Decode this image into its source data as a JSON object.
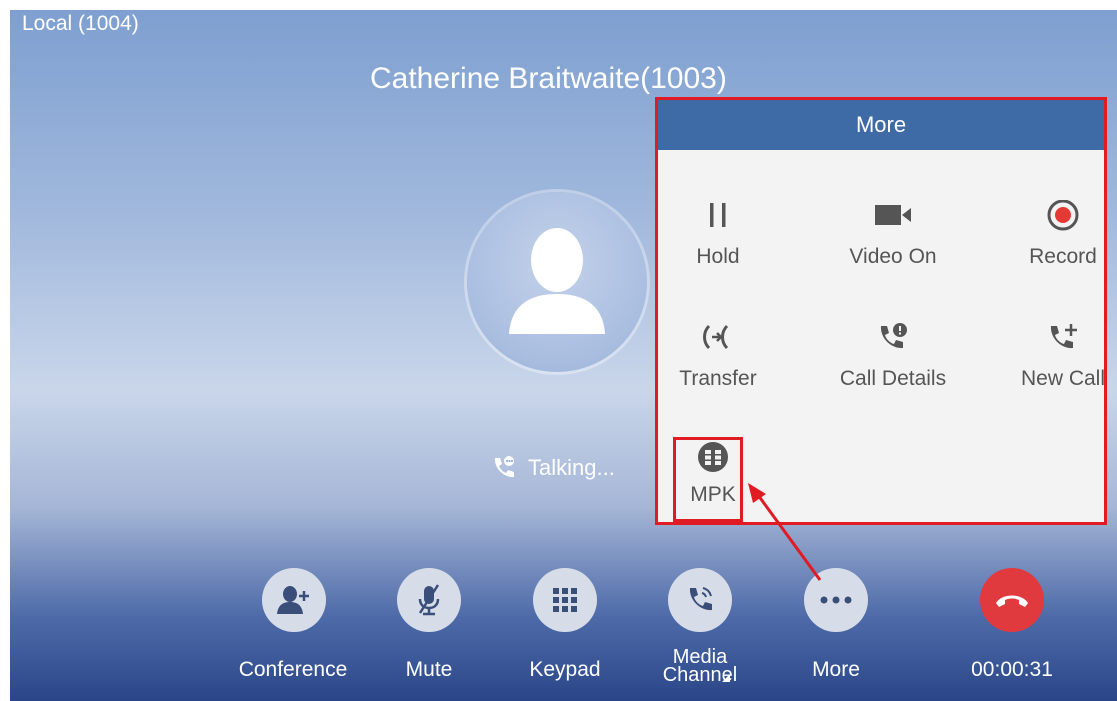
{
  "header": {
    "local_account": "Local (1004)",
    "caller_name": "Catherine Braitwaite(1003)"
  },
  "status": {
    "talking_text": "Talking..."
  },
  "dock": {
    "conference_label": "Conference",
    "mute_label": "Mute",
    "keypad_label": "Keypad",
    "media_label_line1": "Media",
    "media_label_line2": "Channel",
    "more_label": "More",
    "timer": "00:00:31"
  },
  "more_menu": {
    "title": "More",
    "items": [
      {
        "label": "Hold",
        "icon": "pause-icon"
      },
      {
        "label": "Video On",
        "icon": "video-camera-icon"
      },
      {
        "label": "Record",
        "icon": "record-icon"
      },
      {
        "label": "Transfer",
        "icon": "transfer-icon"
      },
      {
        "label": "Call Details",
        "icon": "call-details-icon"
      },
      {
        "label": "New Call",
        "icon": "new-call-icon"
      },
      {
        "label": "MPK",
        "icon": "mpk-icon"
      }
    ]
  },
  "colors": {
    "accent_red": "#e01b24",
    "hangup_red": "#e0393e",
    "header_blue": "#3e6aa6"
  }
}
